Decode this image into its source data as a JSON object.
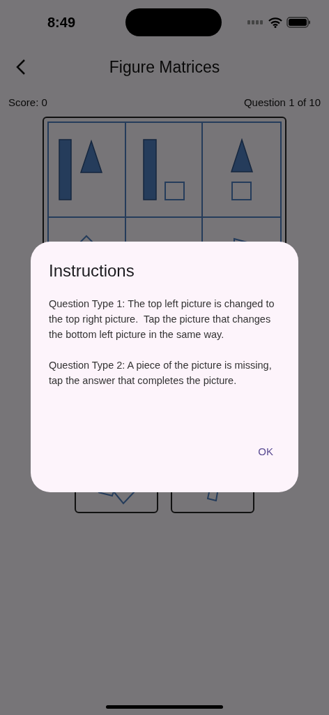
{
  "status_bar": {
    "time": "8:49"
  },
  "header": {
    "title": "Figure Matrices"
  },
  "score": "Score: 0",
  "progress": "Question 1 of 10",
  "dialog": {
    "title": "Instructions",
    "paragraphs": [
      "Question Type 1: The top left picture is changed to the top right picture.  Tap the picture that changes the bottom left picture in the same way.",
      "Question Type 2: A piece of the picture is missing, tap the answer that completes the picture."
    ],
    "button": "OK"
  }
}
